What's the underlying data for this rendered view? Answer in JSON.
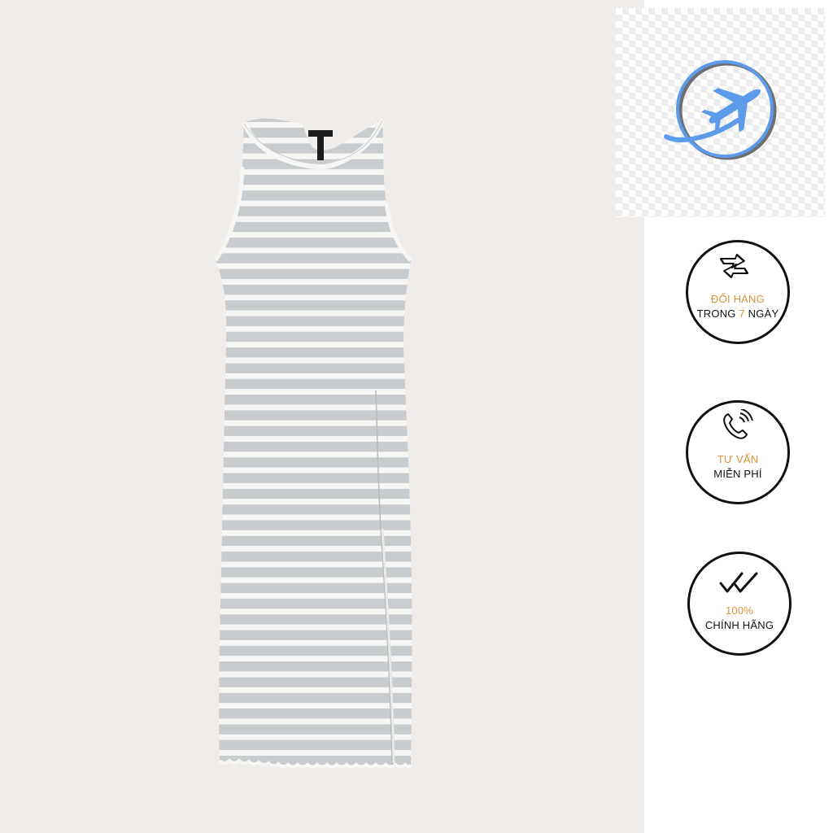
{
  "colors": {
    "background": "#f0ece9",
    "stripe_gray": "#c9ccce",
    "stripe_white": "#f6f6f5",
    "accent_orange": "#d8923a",
    "logo_blue": "#5b9bea",
    "logo_gray": "#6d6f72"
  },
  "product": {
    "image": "striped-sleeveless-midi-dress-icon",
    "label": "tag-icon"
  },
  "logo": {
    "icon": "airplane-globe-logo-icon"
  },
  "badges": [
    {
      "icon": "exchange-arrows-icon",
      "line1": "ĐỔI HÀNG",
      "line2_pre": "TRONG ",
      "line2_accent": "7",
      "line2_post": " NGÀY"
    },
    {
      "icon": "phone-call-icon",
      "line1": "TƯ VẤN",
      "line2": "MIỄN PHÍ"
    },
    {
      "icon": "double-check-icon",
      "line1": "100%",
      "line2": "CHÍNH HÃNG"
    }
  ]
}
